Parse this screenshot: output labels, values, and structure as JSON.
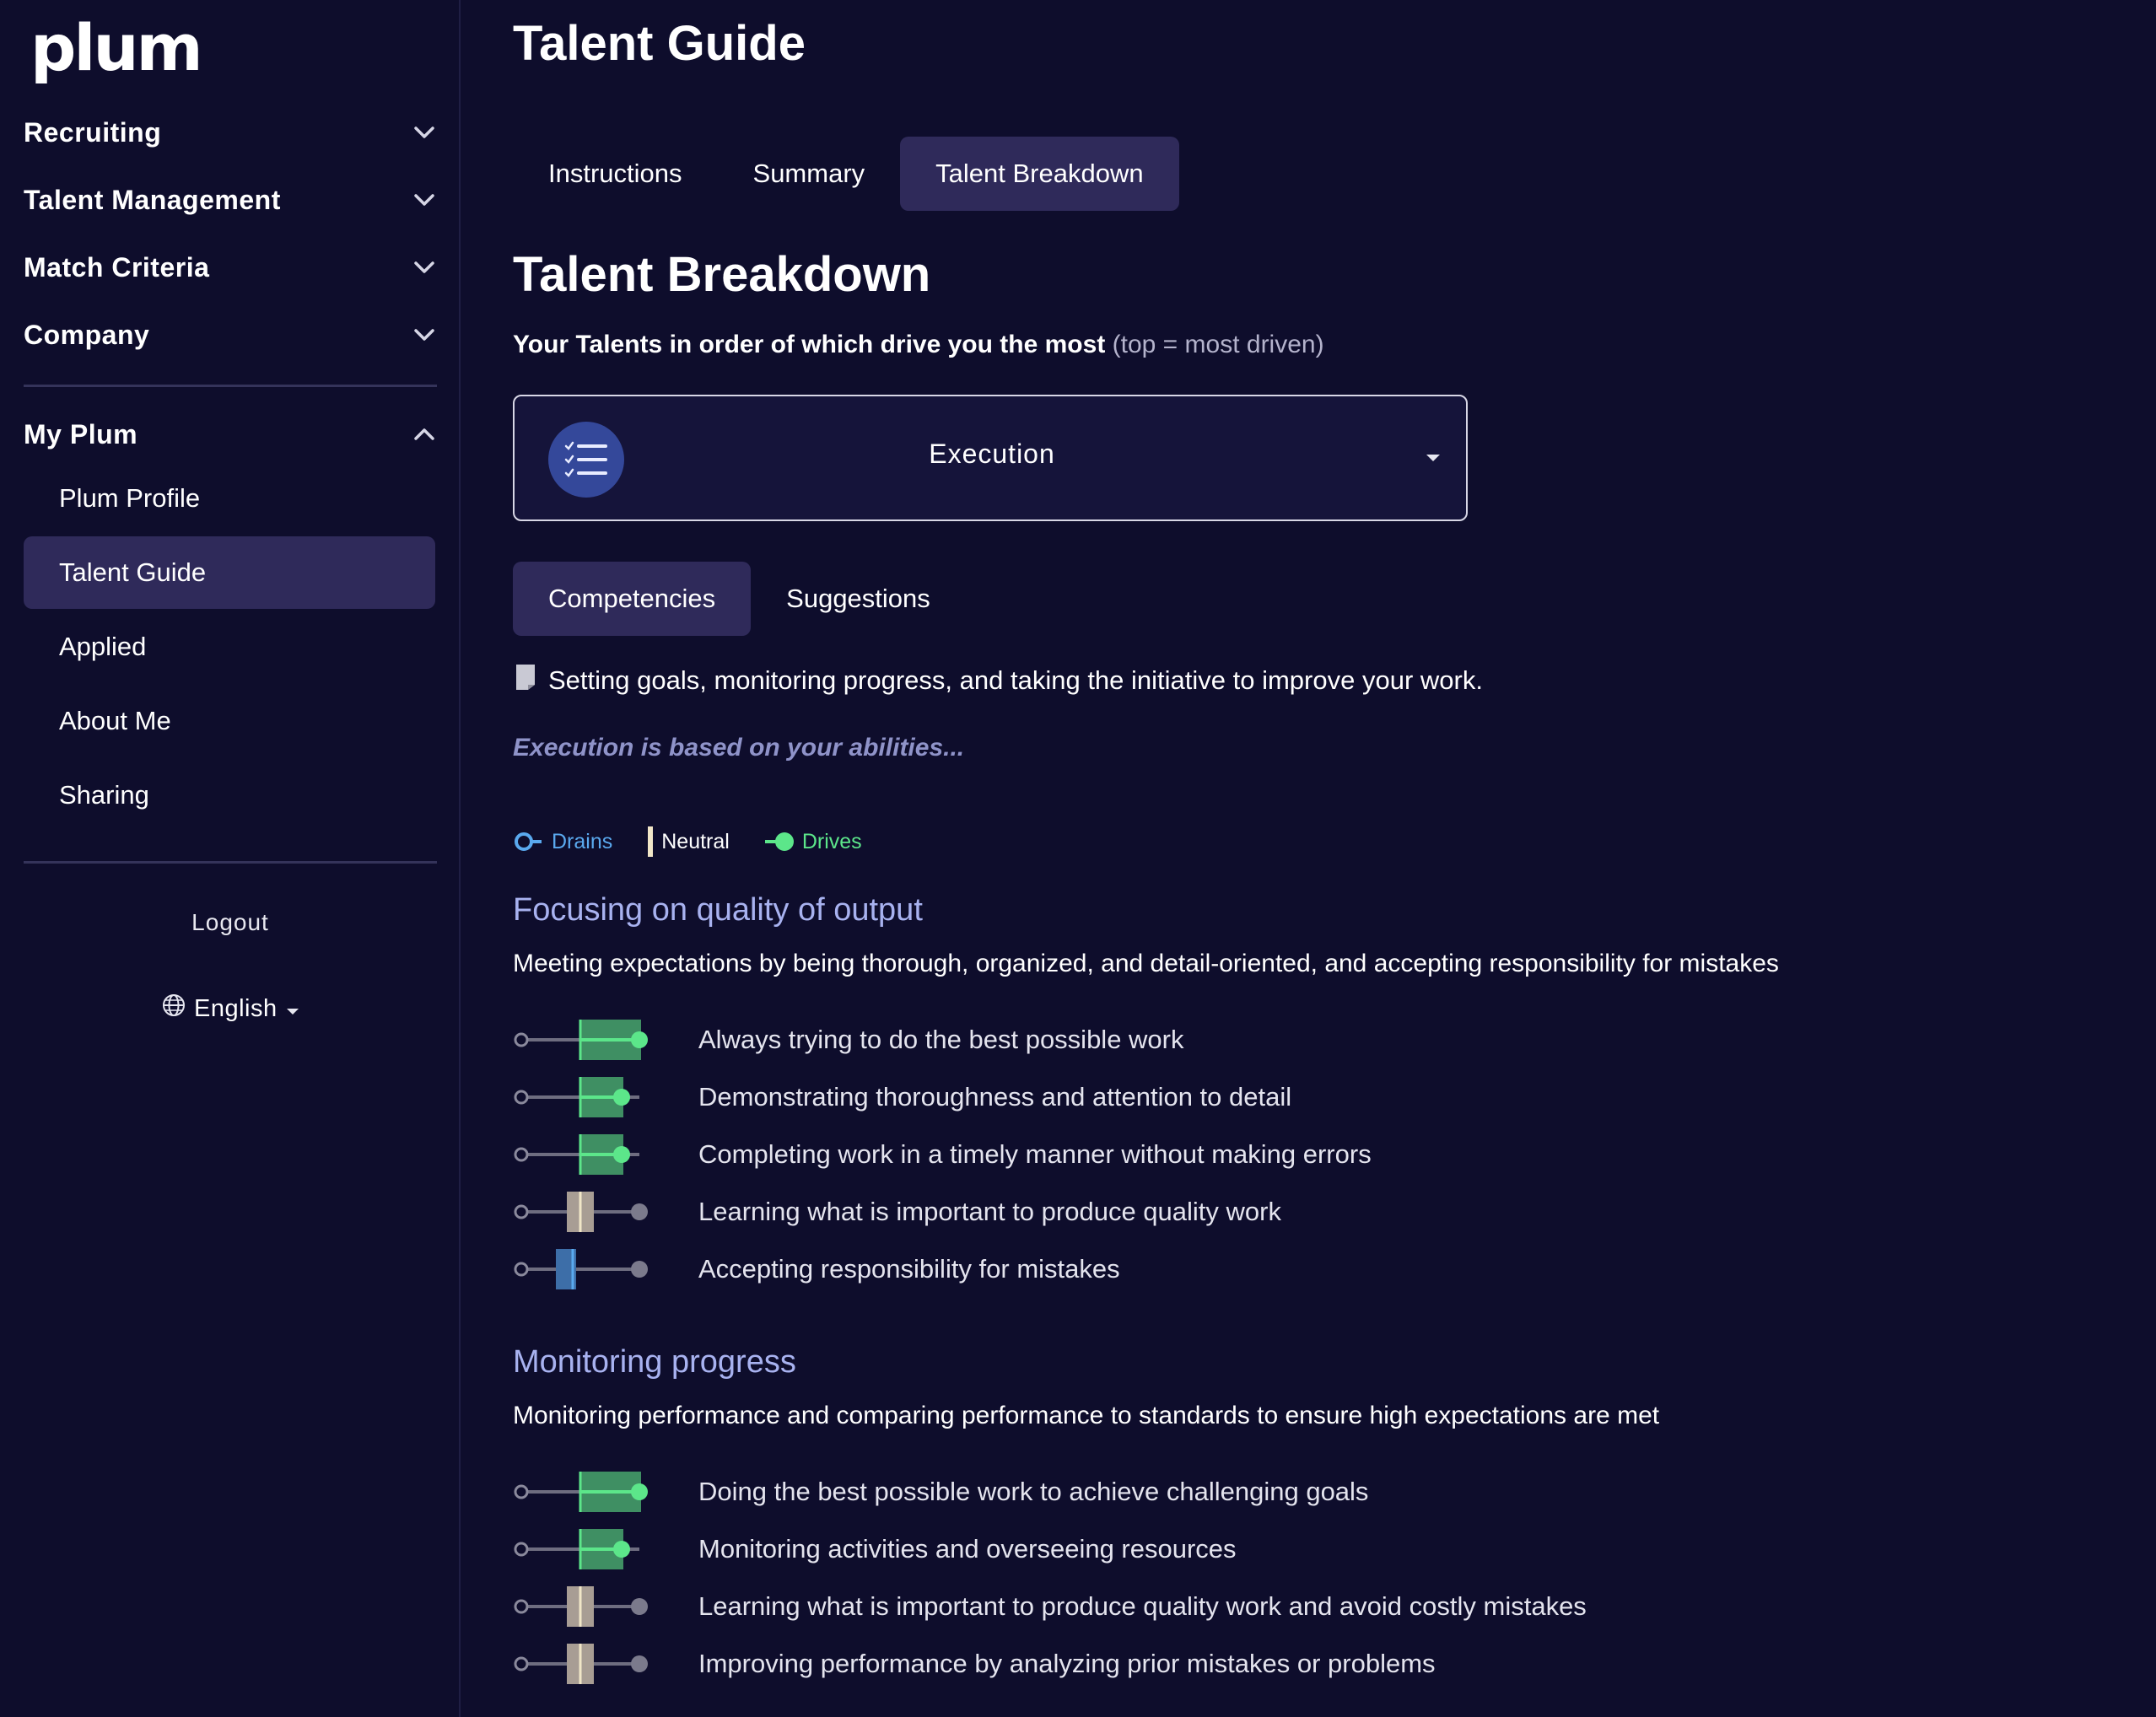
{
  "sidebar": {
    "logo": "plum",
    "sections": [
      {
        "label": "Recruiting"
      },
      {
        "label": "Talent Management"
      },
      {
        "label": "Match Criteria"
      },
      {
        "label": "Company"
      }
    ],
    "my_plum": {
      "label": "My Plum",
      "items": [
        {
          "label": "Plum Profile"
        },
        {
          "label": "Talent Guide"
        },
        {
          "label": "Applied"
        },
        {
          "label": "About Me"
        },
        {
          "label": "Sharing"
        }
      ]
    },
    "logout": "Logout",
    "language": "English"
  },
  "main": {
    "title": "Talent Guide",
    "tabs": [
      {
        "label": "Instructions"
      },
      {
        "label": "Summary"
      },
      {
        "label": "Talent Breakdown"
      }
    ],
    "section_title": "Talent Breakdown",
    "subtitle_strong": "Your Talents in order of which drive you the most",
    "subtitle_muted": "(top = most driven)",
    "talent_select": {
      "value": "Execution",
      "icon": "checklist-icon"
    },
    "subtabs": [
      {
        "label": "Competencies"
      },
      {
        "label": "Suggestions"
      }
    ],
    "description": "Setting goals, monitoring progress, and taking the initiative to improve your work.",
    "based_on": "Execution is based on your abilities...",
    "legend": {
      "drains": "Drains",
      "neutral": "Neutral",
      "drives": "Drives"
    },
    "colors": {
      "drains": "#5aa9ef",
      "neutral": "#f1e6c8",
      "drives": "#5ce68a",
      "drives_bar": "#3f8f63",
      "drains_bar": "#3d6ea8",
      "neutral_bar": "#a89d94"
    },
    "groups": [
      {
        "title": "Focusing on quality of output",
        "description": "Meeting expectations by being thorough, organized, and detail-oriented, and accepting responsibility for mistakes",
        "items": [
          {
            "label": "Always trying to do the best possible work",
            "level": "drives",
            "value": 1.0
          },
          {
            "label": "Demonstrating thoroughness and attention to detail",
            "level": "drives",
            "value": 0.85
          },
          {
            "label": "Completing work in a timely manner without making errors",
            "level": "drives",
            "value": 0.85
          },
          {
            "label": "Learning what is important to produce quality work",
            "level": "neutral",
            "value": 0.5
          },
          {
            "label": "Accepting responsibility for mistakes",
            "level": "drains",
            "value": 0.35
          }
        ]
      },
      {
        "title": "Monitoring progress",
        "description": "Monitoring performance and comparing performance to standards to ensure high expectations are met",
        "items": [
          {
            "label": "Doing the best possible work to achieve challenging goals",
            "level": "drives",
            "value": 1.0
          },
          {
            "label": "Monitoring activities and overseeing resources",
            "level": "drives",
            "value": 0.85
          },
          {
            "label": "Learning what is important to produce quality work and avoid costly mistakes",
            "level": "neutral",
            "value": 0.5
          },
          {
            "label": "Improving performance by analyzing prior mistakes or problems",
            "level": "neutral",
            "value": 0.5
          }
        ]
      }
    ]
  }
}
